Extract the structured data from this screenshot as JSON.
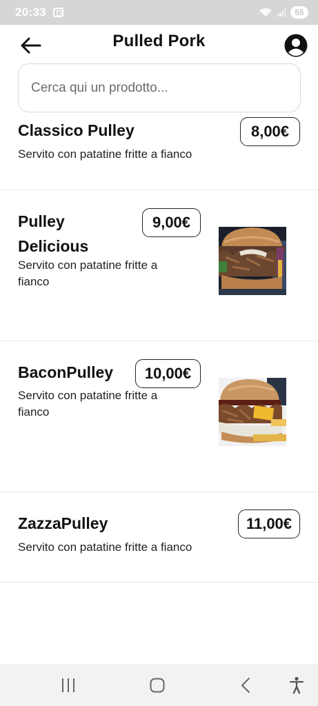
{
  "status_bar": {
    "time": "20:33",
    "battery": "55"
  },
  "header": {
    "title": "Pulled Pork"
  },
  "search": {
    "placeholder": "Cerca qui un prodotto..."
  },
  "products": [
    {
      "name": "Classico Pulley",
      "description": "Servito con patatine fritte a fianco",
      "price": "8,00€"
    },
    {
      "name": "Pulley Delicious",
      "name_line1": "Pulley",
      "name_line2": "Delicious",
      "description_line1": "Servito con patatine fritte a",
      "description_line2": "fianco",
      "price": "9,00€",
      "image": "pulled-pork-burger-photo"
    },
    {
      "name": "BaconPulley",
      "description_line1": "Servito con patatine fritte a",
      "description_line2": "fianco",
      "price": "10,00€",
      "image": "bacon-pulled-pork-burger-photo"
    },
    {
      "name": "ZazzaPulley",
      "description": "Servito con patatine fritte a fianco",
      "price": "11,00€"
    }
  ],
  "nav_bar": {
    "icons": [
      "recent-apps-icon",
      "home-icon",
      "back-icon",
      "accessibility-icon"
    ]
  },
  "colors": {
    "status_bar_bg": "#d6d6d6",
    "text": "#111111",
    "divider": "#e6e6e6",
    "nav_bar_bg": "#f2f2f2"
  }
}
